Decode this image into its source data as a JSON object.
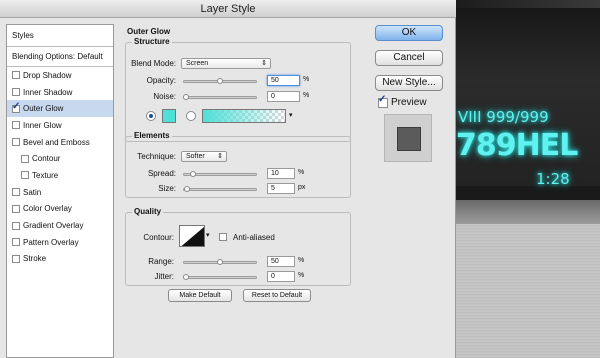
{
  "window": {
    "title": "Layer Style"
  },
  "styles_panel": {
    "header": "Styles",
    "blending_options": "Blending Options: Default",
    "items": [
      {
        "label": "Drop Shadow",
        "checked": false,
        "indent": false
      },
      {
        "label": "Inner Shadow",
        "checked": false,
        "indent": false
      },
      {
        "label": "Outer Glow",
        "checked": true,
        "indent": false,
        "selected": true
      },
      {
        "label": "Inner Glow",
        "checked": false,
        "indent": false
      },
      {
        "label": "Bevel and Emboss",
        "checked": false,
        "indent": false
      },
      {
        "label": "Contour",
        "checked": false,
        "indent": true
      },
      {
        "label": "Texture",
        "checked": false,
        "indent": true
      },
      {
        "label": "Satin",
        "checked": false,
        "indent": false
      },
      {
        "label": "Color Overlay",
        "checked": false,
        "indent": false
      },
      {
        "label": "Gradient Overlay",
        "checked": false,
        "indent": false
      },
      {
        "label": "Pattern Overlay",
        "checked": false,
        "indent": false
      },
      {
        "label": "Stroke",
        "checked": false,
        "indent": false
      }
    ]
  },
  "outer_glow": {
    "title": "Outer Glow",
    "structure": {
      "title": "Structure",
      "blend_mode_label": "Blend Mode:",
      "blend_mode_value": "Screen",
      "opacity_label": "Opacity:",
      "opacity_value": "50",
      "noise_label": "Noise:",
      "noise_value": "0",
      "percent_unit": "%",
      "glow_color": "#4fe0d8",
      "opacity_level": 0.5,
      "noise_level": 0.0
    },
    "elements": {
      "title": "Elements",
      "technique_label": "Technique:",
      "technique_value": "Softer",
      "spread_label": "Spread:",
      "spread_value": "10",
      "size_label": "Size:",
      "size_value": "5",
      "percent_unit": "%",
      "px_unit": "px",
      "spread_level": 0.1,
      "size_level": 0.02
    },
    "quality": {
      "title": "Quality",
      "contour_label": "Contour:",
      "anti_aliased_label": "Anti-aliased",
      "range_label": "Range:",
      "range_value": "50",
      "jitter_label": "Jitter:",
      "jitter_value": "0",
      "percent_unit": "%",
      "range_level": 0.5,
      "jitter_level": 0.0
    },
    "make_default": "Make Default",
    "reset_to_default": "Reset to Default"
  },
  "actions": {
    "ok": "OK",
    "cancel": "Cancel",
    "new_style": "New Style...",
    "preview_label": "Preview",
    "preview_checked": true
  },
  "canvas": {
    "line1": "VIII 999/999",
    "line2": "789HEL",
    "line3": "1:28",
    "glow_color": "#5ff2ee"
  }
}
